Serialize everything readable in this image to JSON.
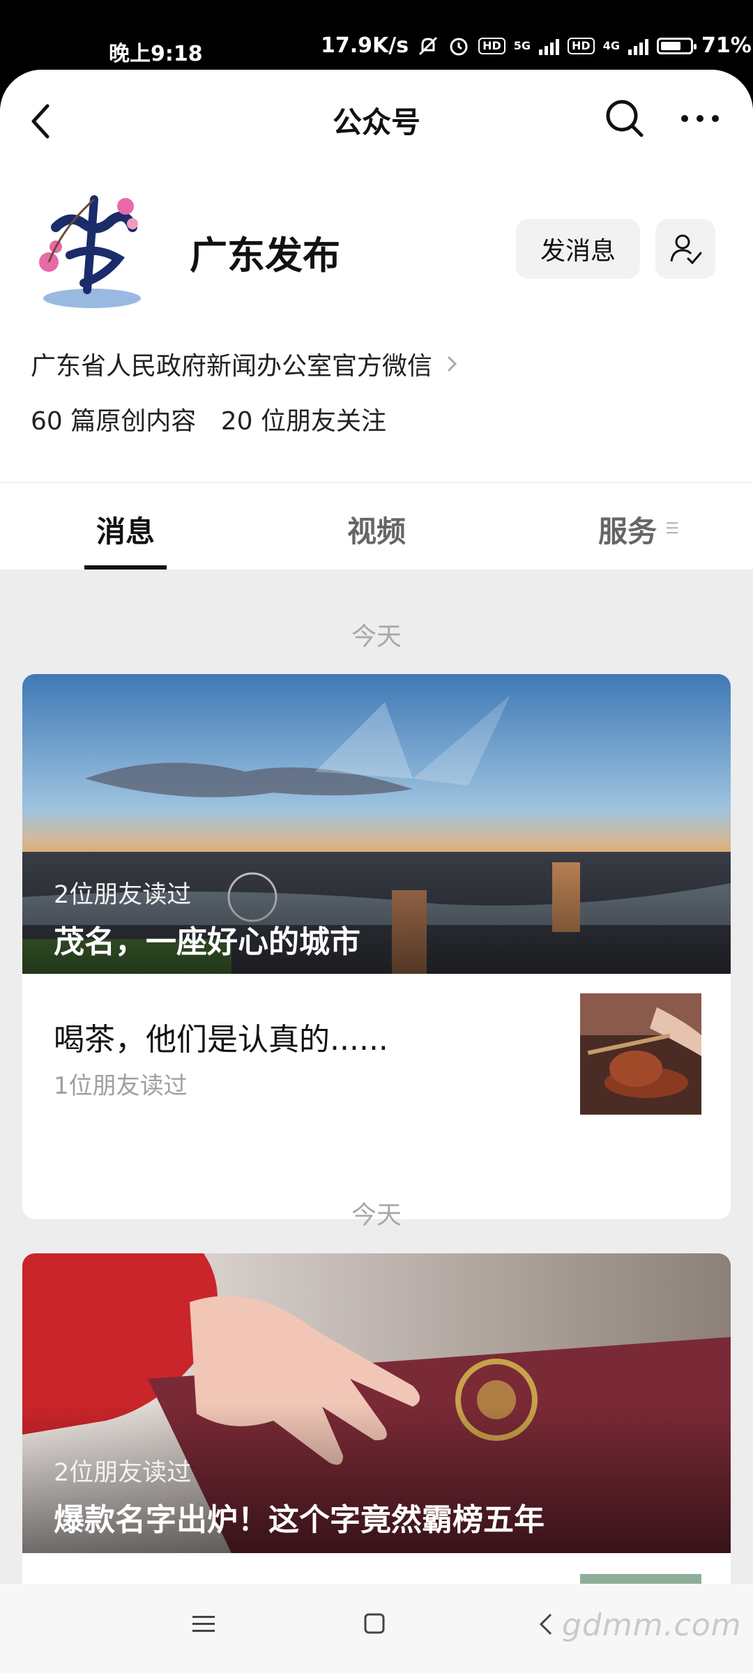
{
  "status_bar": {
    "time": "晚上9:18",
    "speed": "17.9K/s",
    "net1": "5G",
    "net2": "4G",
    "hd": "HD",
    "battery": "71%",
    "battery_level": 0.71
  },
  "navbar": {
    "title": "公众号"
  },
  "account": {
    "name": "广东发布",
    "message_button": "发消息",
    "description": "广东省人民政府新闻办公室官方微信",
    "original_count": "60 篇原创内容",
    "friends_follow": "20 位朋友关注"
  },
  "tabs": [
    {
      "label": "消息"
    },
    {
      "label": "视频"
    },
    {
      "label": "服务"
    }
  ],
  "feed": [
    {
      "date": "今天",
      "hero_reads": "2位朋友读过",
      "hero_title": "茂名，一座好心的城市",
      "sub_title": "喝茶，他们是认真的......",
      "sub_reads": "1位朋友读过"
    },
    {
      "date": "今天",
      "hero_reads": "2位朋友读过",
      "hero_title": "爆款名字出炉！这个字竟然霸榜五年"
    }
  ],
  "bottom_nav": {
    "watermark": "gdmm.com"
  },
  "colors": {
    "background": "#ededed",
    "card": "#ffffff",
    "text": "#111111",
    "muted": "#a0a0a0"
  }
}
